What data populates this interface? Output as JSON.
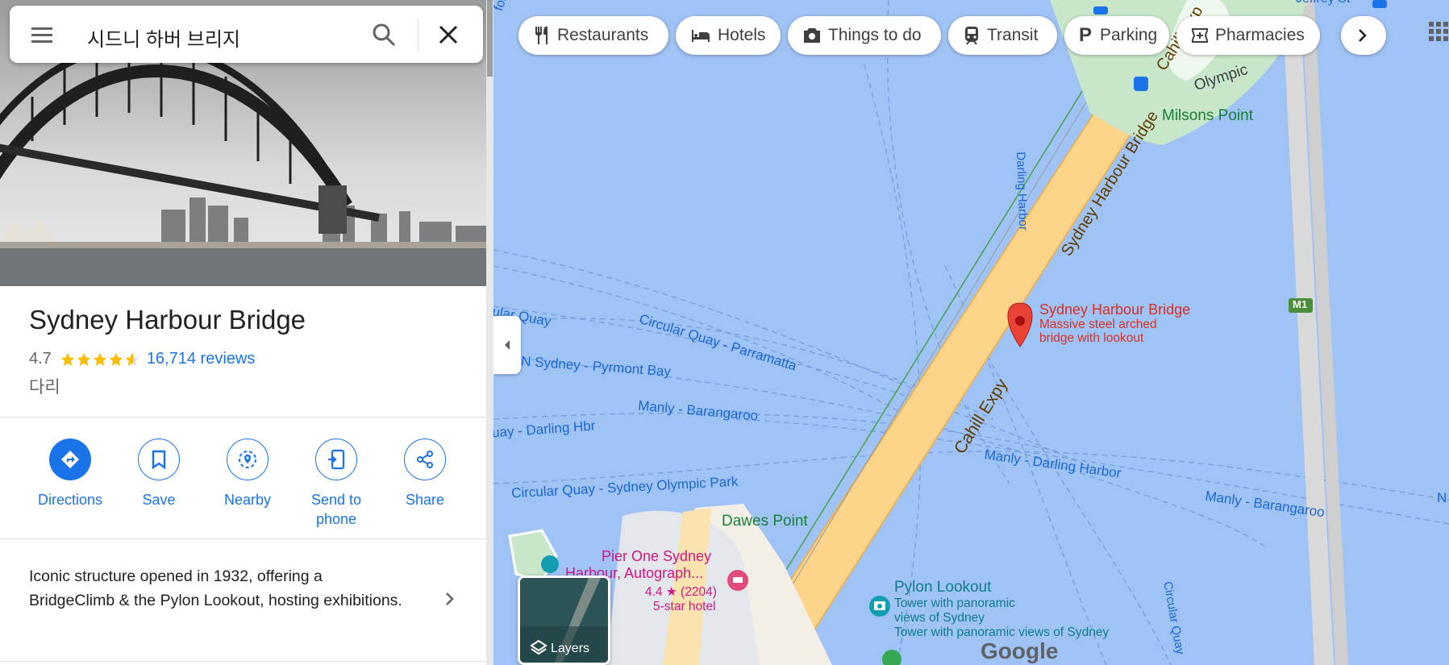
{
  "search": {
    "query": "시드니 하버 브리지"
  },
  "place": {
    "name": "Sydney Harbour Bridge",
    "rating": "4.7",
    "rating_value": 4.7,
    "reviews": "16,714 reviews",
    "category": "다리",
    "description": "Iconic structure opened in 1932, offering a BridgeClimb & the Pylon Lookout, hosting exhibitions."
  },
  "actions": [
    {
      "label": "Directions",
      "icon": "directions-icon"
    },
    {
      "label": "Save",
      "icon": "bookmark-icon"
    },
    {
      "label": "Nearby",
      "icon": "nearby-icon"
    },
    {
      "label": "Send to\nphone",
      "icon": "send-to-phone-icon"
    },
    {
      "label": "Share",
      "icon": "share-icon"
    }
  ],
  "chips": [
    {
      "label": "Restaurants",
      "icon": "fork-knife-icon"
    },
    {
      "label": "Hotels",
      "icon": "bed-icon"
    },
    {
      "label": "Things to do",
      "icon": "camera-icon"
    },
    {
      "label": "Transit",
      "icon": "train-icon"
    },
    {
      "label": "Parking",
      "icon": "parking-icon"
    },
    {
      "label": "Pharmacies",
      "icon": "pharmacy-icon"
    }
  ],
  "map": {
    "marker_title": "Sydney Harbour Bridge",
    "marker_desc_1": "Massive steel arched",
    "marker_desc_2": "bridge with lookout",
    "milsons_point": "Milsons Point",
    "olympic": "Olympic",
    "cahill_top": "Cahill Exp",
    "sydney_harbour_bridge_road": "Sydney Harbour Bridge",
    "cahill_expy": "Cahill Expy",
    "darling_harbor_v": "Darling Harbor",
    "circular_quay_parramatta": "Circular Quay - Parramatta",
    "circular_quay_left": "ular Quay",
    "n_sydney_pyrmont": "N Sydney - Pyrmont Bay",
    "manly_barangaroo": "Manly - Barangaroo",
    "quay_darling_hbr": "uay - Darling Hbr",
    "circular_quay_olympic": "Circular Quay - Sydney Olympic Park",
    "manly_darling_harbor": "Manly - Darling Harbor",
    "manly_barangaroo_right": "Manly - Barangaroo",
    "n_edge": "N",
    "dawes_point": "Dawes Point",
    "pier_one_1": "Pier One Sydney",
    "pier_one_2": "Harbour, Autograph...",
    "pier_one_rating": "4.4 ★ (2204)",
    "pier_one_class": "5-star hotel",
    "pylon_lookout": "Pylon Lookout",
    "pylon_desc_1": "Tower with panoramic",
    "pylon_desc_2": "views of Sydney",
    "pylon_desc_3": "Tower with panoramic views of Sydney",
    "circular_quay_v": "Circular Quay",
    "m1": "M1",
    "jeffrey": "Jeffrey St",
    "ford": "ford",
    "google": "Google",
    "layers": "Layers"
  },
  "colors": {
    "accent": "#1a73e8",
    "water": "#9fc3f5",
    "road": "#fdd58a",
    "marker": "#ea4335",
    "star": "#fbbc04",
    "teal": "#129eaf"
  }
}
